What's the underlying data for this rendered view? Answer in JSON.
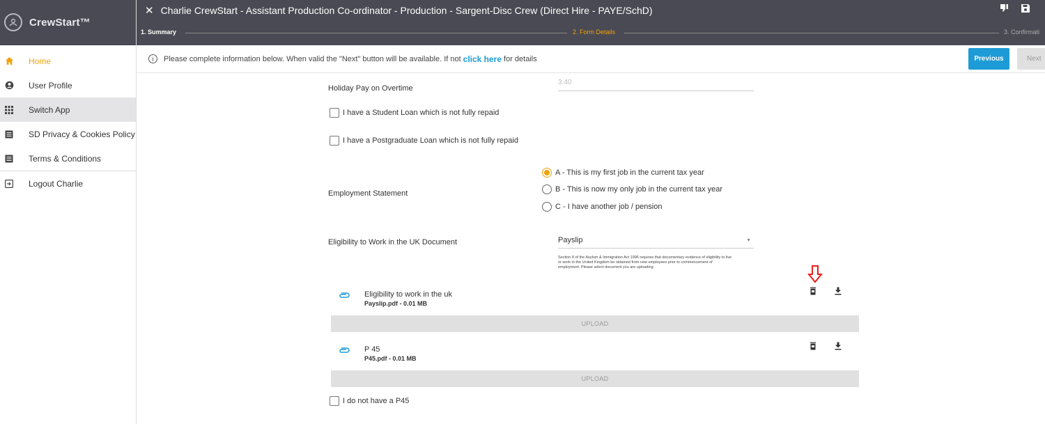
{
  "app": {
    "brand": "CrewStart™"
  },
  "sidebar": {
    "items": [
      {
        "label": "Home"
      },
      {
        "label": "User Profile"
      },
      {
        "label": "Switch App"
      },
      {
        "label": "SD Privacy & Cookies Policy"
      },
      {
        "label": "Terms & Conditions"
      },
      {
        "label": "Logout Charlie"
      }
    ]
  },
  "header": {
    "title": "Charlie CrewStart - Assistant Production Co-ordinator - Production - Sargent-Disc Crew (Direct Hire - PAYE/SchD)",
    "steps": [
      "1. Summary",
      "2. Form Details",
      "3. Confirmati"
    ]
  },
  "info": {
    "before": "Please complete information below. When valid the \"Next\" button will be available. If not",
    "link": "click here",
    "after": "for details",
    "previous": "Previous",
    "next": "Next"
  },
  "form": {
    "holiday_label": "Holiday Pay on Overtime",
    "holiday_value": "3.40",
    "student_loan": "I have a Student Loan which is not fully repaid",
    "postgrad_loan": "I have a Postgraduate Loan which is not fully repaid",
    "employment_label": "Employment Statement",
    "employment_options": [
      "A - This is my first job in the current tax year",
      "B - This is now my only job in the current tax year",
      "C - I have another job / pension"
    ],
    "eligibility_label": "Eligibility to Work in the UK Document",
    "eligibility_value": "Payslip",
    "eligibility_hint": "Section 8 of the Asylum & Immigration Act 1996 requires that documentary evidence of eligibility to live or work in the United Kingdom be obtained from new employees prior to commencement of employment. Please select document you are uploading.",
    "documents": [
      {
        "title": "Eligibility to work in the uk",
        "file": "Payslip.pdf - 0.01 MB",
        "upload": "UPLOAD"
      },
      {
        "title": "P 45",
        "file": "P45.pdf - 0.01 MB",
        "upload": "UPLOAD"
      }
    ],
    "no_p45": "I do not have a P45"
  },
  "colors": {
    "accent": "#f0a30a",
    "primary": "#1d9bd6",
    "header_bg": "#4a4a54",
    "arrow": "#e8201a"
  }
}
